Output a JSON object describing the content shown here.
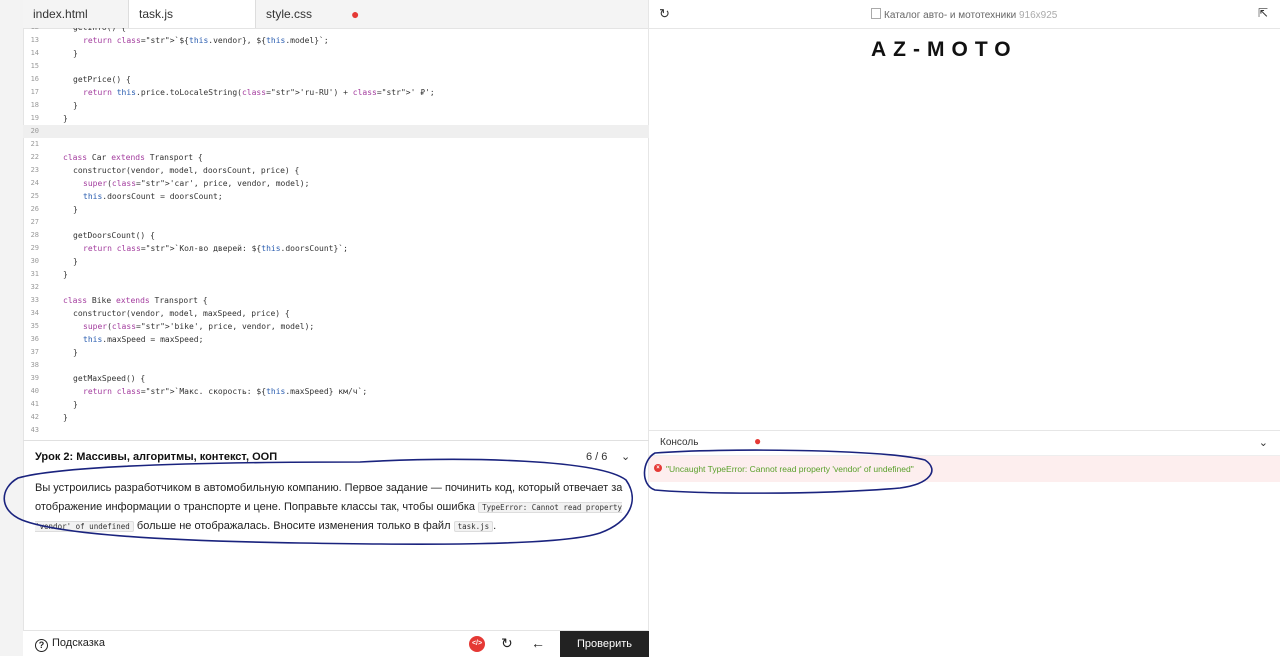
{
  "tabs": [
    {
      "label": "index.html",
      "active": false
    },
    {
      "label": "task.js",
      "active": true
    },
    {
      "label": "style.css",
      "active": false
    }
  ],
  "code_lines": [
    {
      "n": "12",
      "indent": 1,
      "html": "getInfo() {"
    },
    {
      "n": "13",
      "indent": 2,
      "html": "return `${this.vendor}, ${this.model}`;"
    },
    {
      "n": "14",
      "indent": 1,
      "html": "}"
    },
    {
      "n": "15",
      "indent": 0,
      "html": ""
    },
    {
      "n": "16",
      "indent": 1,
      "html": "getPrice() {"
    },
    {
      "n": "17",
      "indent": 2,
      "html": "return this.price.toLocaleString('ru-RU') + ' ₽';"
    },
    {
      "n": "18",
      "indent": 1,
      "html": "}"
    },
    {
      "n": "19",
      "indent": 0,
      "html": "}"
    },
    {
      "n": "20",
      "indent": 0,
      "html": ""
    },
    {
      "n": "21",
      "indent": 0,
      "html": ""
    },
    {
      "n": "22",
      "indent": 0,
      "html": "class Car extends Transport {"
    },
    {
      "n": "23",
      "indent": 1,
      "html": "constructor(vendor, model, doorsCount, price) {"
    },
    {
      "n": "24",
      "indent": 2,
      "html": "super('car', price, vendor, model);"
    },
    {
      "n": "25",
      "indent": 2,
      "html": "this.doorsCount = doorsCount;"
    },
    {
      "n": "26",
      "indent": 1,
      "html": "}"
    },
    {
      "n": "27",
      "indent": 0,
      "html": ""
    },
    {
      "n": "28",
      "indent": 1,
      "html": "getDoorsCount() {"
    },
    {
      "n": "29",
      "indent": 2,
      "html": "return `Кол-во дверей: ${this.doorsCount}`;"
    },
    {
      "n": "30",
      "indent": 1,
      "html": "}"
    },
    {
      "n": "31",
      "indent": 0,
      "html": "}"
    },
    {
      "n": "32",
      "indent": 0,
      "html": ""
    },
    {
      "n": "33",
      "indent": 0,
      "html": "class Bike extends Transport {"
    },
    {
      "n": "34",
      "indent": 1,
      "html": "constructor(vendor, model, maxSpeed, price) {"
    },
    {
      "n": "35",
      "indent": 2,
      "html": "super('bike', price, vendor, model);"
    },
    {
      "n": "36",
      "indent": 2,
      "html": "this.maxSpeed = maxSpeed;"
    },
    {
      "n": "37",
      "indent": 1,
      "html": "}"
    },
    {
      "n": "38",
      "indent": 0,
      "html": ""
    },
    {
      "n": "39",
      "indent": 1,
      "html": "getMaxSpeed() {"
    },
    {
      "n": "40",
      "indent": 2,
      "html": "return `Макс. скорость: ${this.maxSpeed} км/ч`;"
    },
    {
      "n": "41",
      "indent": 1,
      "html": "}"
    },
    {
      "n": "42",
      "indent": 0,
      "html": "}"
    },
    {
      "n": "43",
      "indent": 0,
      "html": ""
    }
  ],
  "highlighted_line": "20",
  "task": {
    "title": "Урок 2: Массивы, алгоритмы, контекст, ООП",
    "count": "6 / 6",
    "text_1": "Вы устроились разработчиком в автомобильную компанию. Первое задание — починить код, который отвечает за отображение информации о транспорте и цене. Поправьте классы так, чтобы ошибка",
    "code_1": "TypeError: Cannot read property 'vendor' of undefined",
    "text_2": "больше не отображалась. Вносите изменения только в файл",
    "code_2": "task.js",
    "text_3": "."
  },
  "bottom": {
    "hint_label": "Подсказка",
    "code_icon": "</>",
    "check_label": "Проверить"
  },
  "preview": {
    "title": "Каталог авто- и мототехники",
    "size": "916x925",
    "logo": "AZ-MOTO"
  },
  "console": {
    "label": "Консоль",
    "error": "\"Uncaught TypeError: Cannot read property 'vendor' of undefined\""
  },
  "icons": {
    "reload": "reload-icon",
    "expand": "expand-icon",
    "chevron": "chevron-down-icon",
    "help": "help-icon",
    "reset": "reset-icon",
    "back": "arrow-left-icon",
    "error": "error-icon"
  },
  "colors": {
    "accent": "#e53935",
    "check_button": "#222222",
    "error_bg": "#fdeeee",
    "error_text": "#5aa02c",
    "annotation": "#1a237e"
  }
}
